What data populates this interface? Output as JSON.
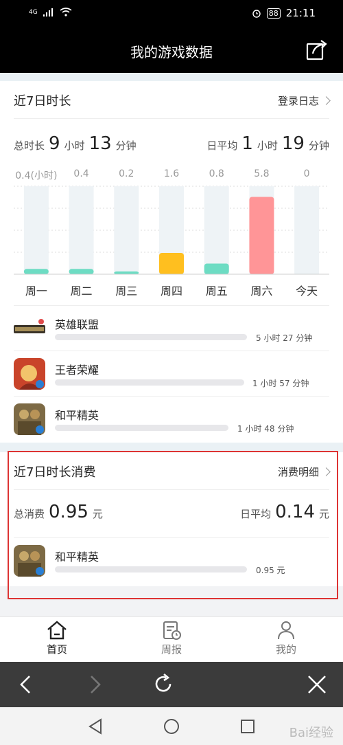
{
  "status_bar": {
    "signal": "4G",
    "battery": "88",
    "time": "21:11"
  },
  "header": {
    "title": "我的游戏数据"
  },
  "playtime": {
    "title": "近7日时长",
    "log_link": "登录日志",
    "total_label": "总时长",
    "total_hours": "9",
    "hours_unit": "小时",
    "total_minutes": "13",
    "minutes_unit": "分钟",
    "avg_label": "日平均",
    "avg_hours": "1",
    "avg_minutes": "19",
    "value_labels": [
      "0.4(小时)",
      "0.4",
      "0.2",
      "1.6",
      "0.8",
      "5.8",
      "0"
    ]
  },
  "chart_data": {
    "type": "bar",
    "categories": [
      "周一",
      "周二",
      "周三",
      "周四",
      "周五",
      "周六",
      "今天"
    ],
    "values": [
      0.4,
      0.4,
      0.2,
      1.6,
      0.8,
      5.8,
      0
    ],
    "ylabel": "小时",
    "ylim": [
      0,
      6.6
    ],
    "colors": [
      "#6ddcc3",
      "#6ddcc3",
      "#6ddcc3",
      "#ffbf1f",
      "#6ddcc3",
      "#ff9597",
      "#6ddcc3"
    ],
    "track_color": "#eef3f6"
  },
  "games": [
    {
      "name": "英雄联盟",
      "time": "5 小时  27 分钟",
      "icon": "league-of-legends-logo"
    },
    {
      "name": "王者荣耀",
      "time": "1 小时  57 分钟",
      "icon": "honor-of-kings-icon"
    },
    {
      "name": "和平精英",
      "time": "1 小时  48 分钟",
      "icon": "game-for-peace-icon"
    }
  ],
  "spending": {
    "title": "近7日时长消费",
    "detail_link": "消费明细",
    "total_label": "总消费",
    "total_value": "0.95",
    "currency": "元",
    "avg_label": "日平均",
    "avg_value": "0.14",
    "game": {
      "name": "和平精英",
      "amount": "0.95 元",
      "icon": "game-for-peace-icon"
    }
  },
  "bottom_nav": [
    {
      "label": "首页",
      "icon": "home-icon",
      "active": true
    },
    {
      "label": "周报",
      "icon": "weekly-report-icon",
      "active": false
    },
    {
      "label": "我的",
      "icon": "profile-icon",
      "active": false
    }
  ],
  "watermark": "Bai经验"
}
